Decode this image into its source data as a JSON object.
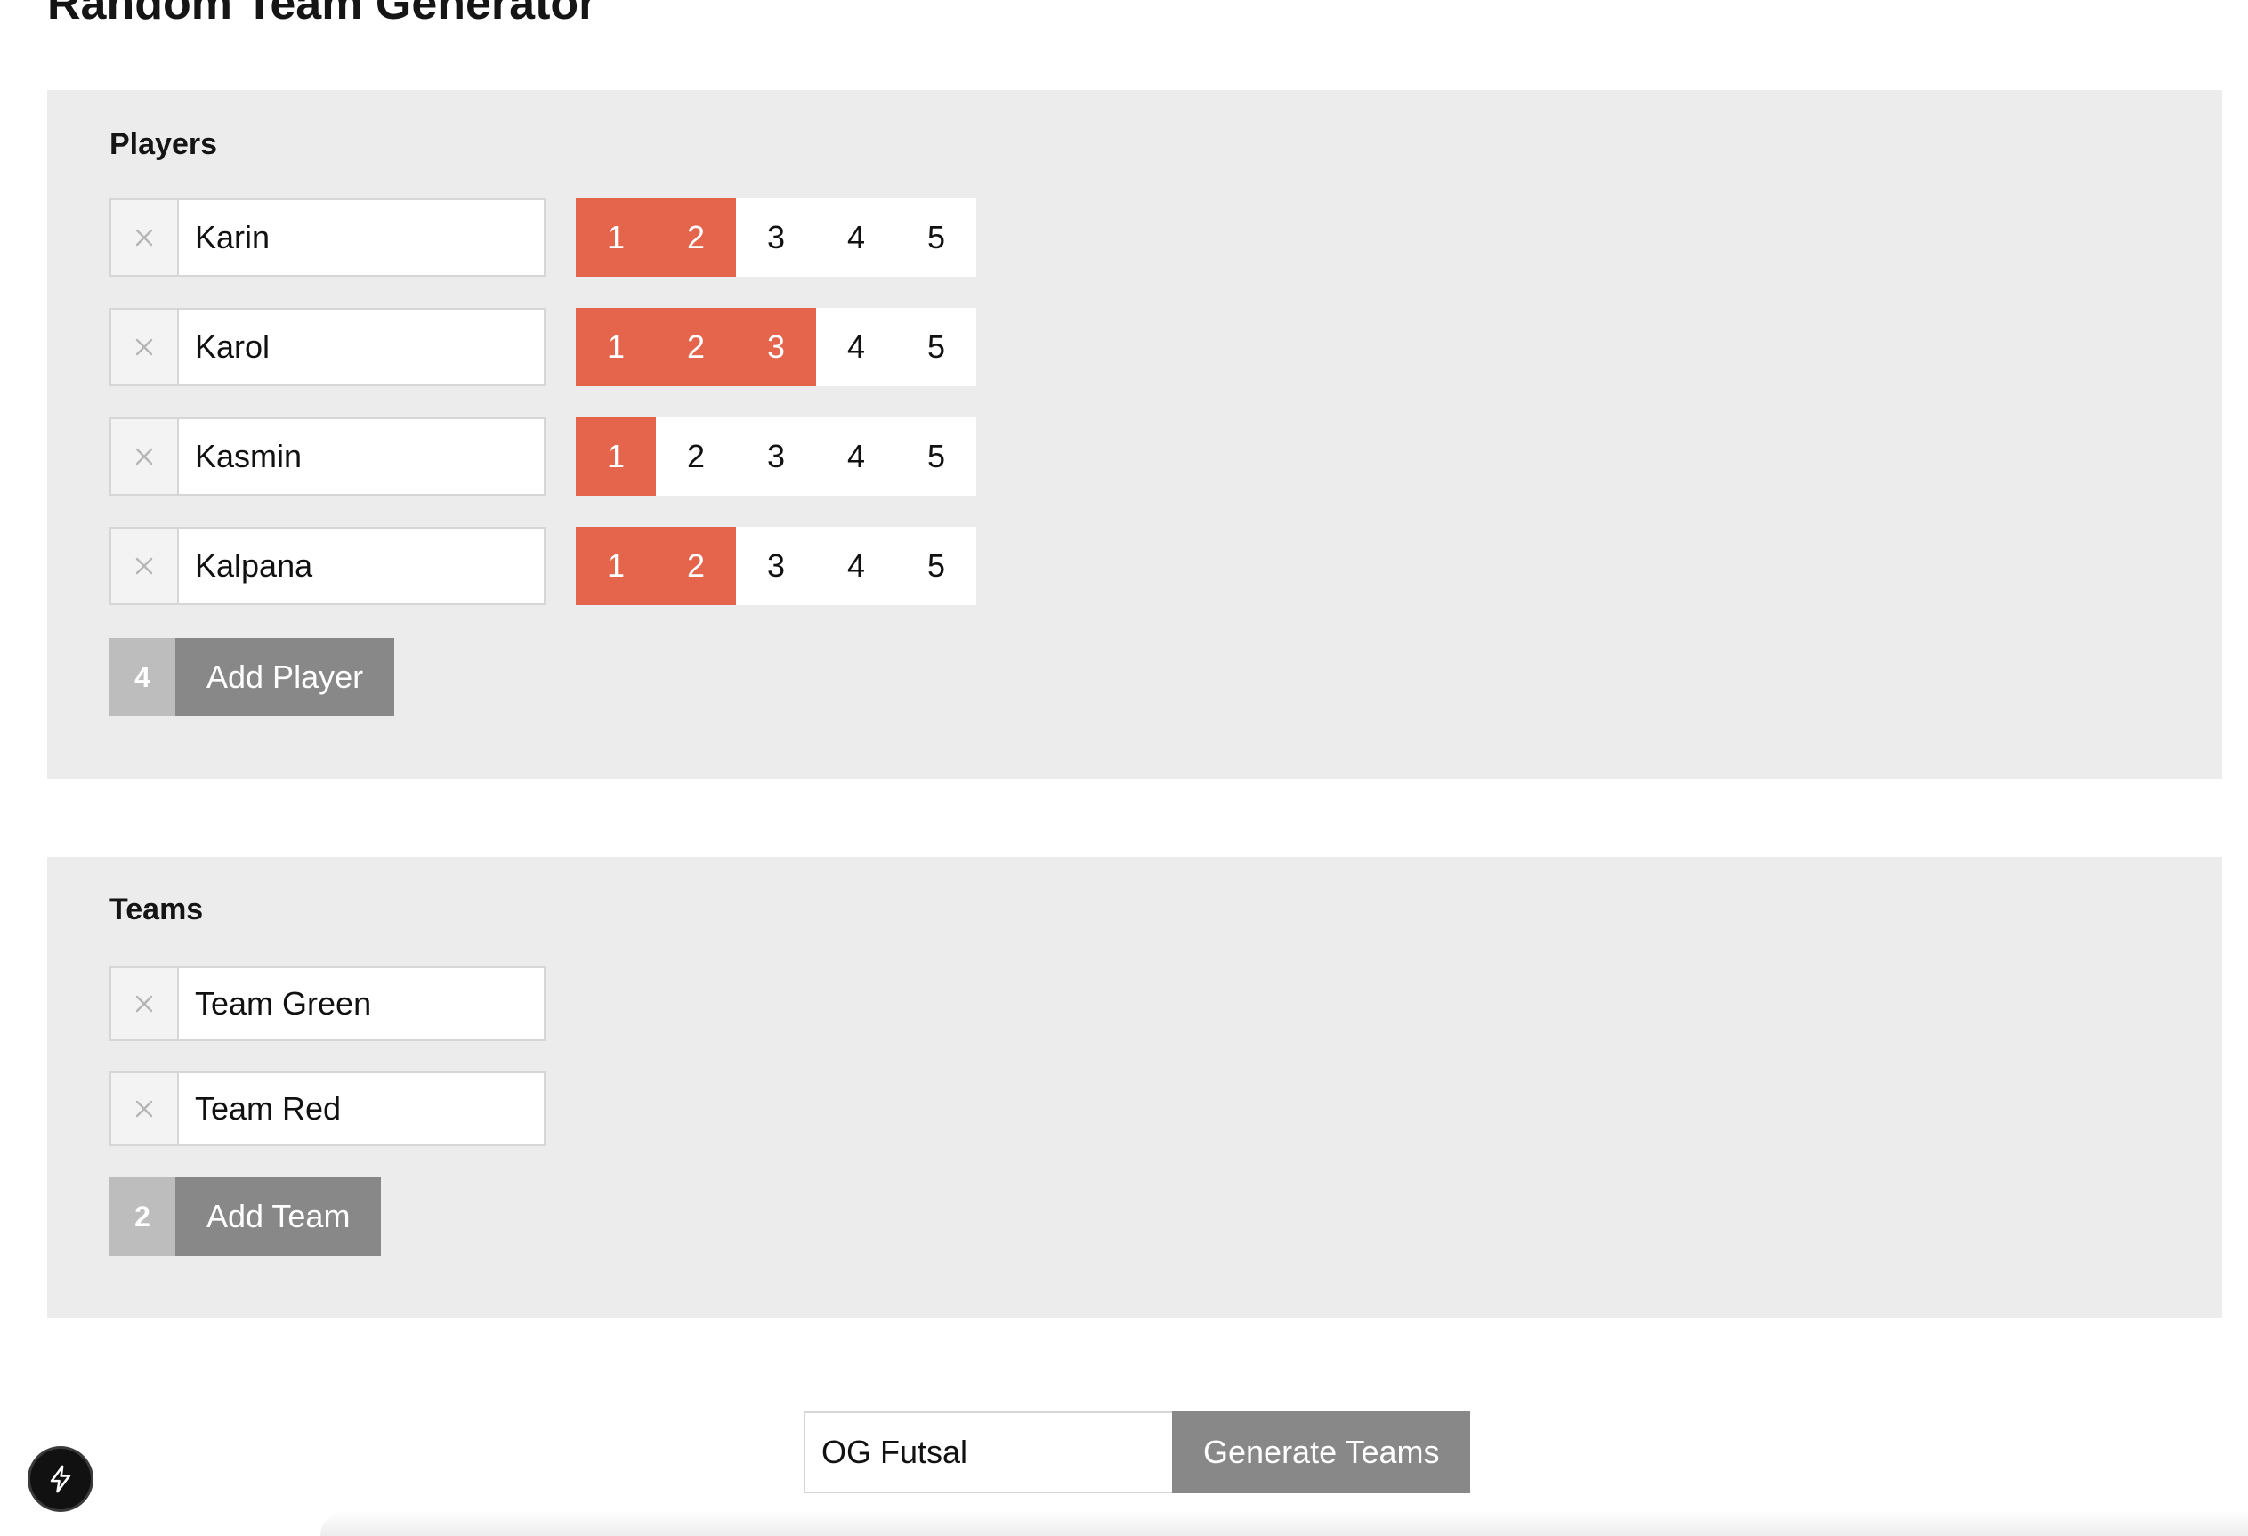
{
  "page": {
    "title": "Random Team Generator"
  },
  "players_section": {
    "heading": "Players",
    "rating_scale": [
      "1",
      "2",
      "3",
      "4",
      "5"
    ],
    "players": [
      {
        "name": "Karin",
        "rating": 2
      },
      {
        "name": "Karol",
        "rating": 3
      },
      {
        "name": "Kasmin",
        "rating": 1
      },
      {
        "name": "Kalpana",
        "rating": 2
      }
    ],
    "add_button": {
      "count": "4",
      "label": "Add Player"
    }
  },
  "teams_section": {
    "heading": "Teams",
    "teams": [
      {
        "name": "Team Green"
      },
      {
        "name": "Team Red"
      }
    ],
    "add_button": {
      "count": "2",
      "label": "Add Team"
    }
  },
  "generate": {
    "collection_name": "OG Futsal",
    "button_label": "Generate Teams"
  },
  "icons": {
    "remove": "close-icon",
    "badge": "lightning-bolt-icon"
  },
  "colors": {
    "rating_active": "#e4654c",
    "button_gray": "#888888",
    "count_gray": "#bdbdbd",
    "panel_bg": "#ececec"
  }
}
